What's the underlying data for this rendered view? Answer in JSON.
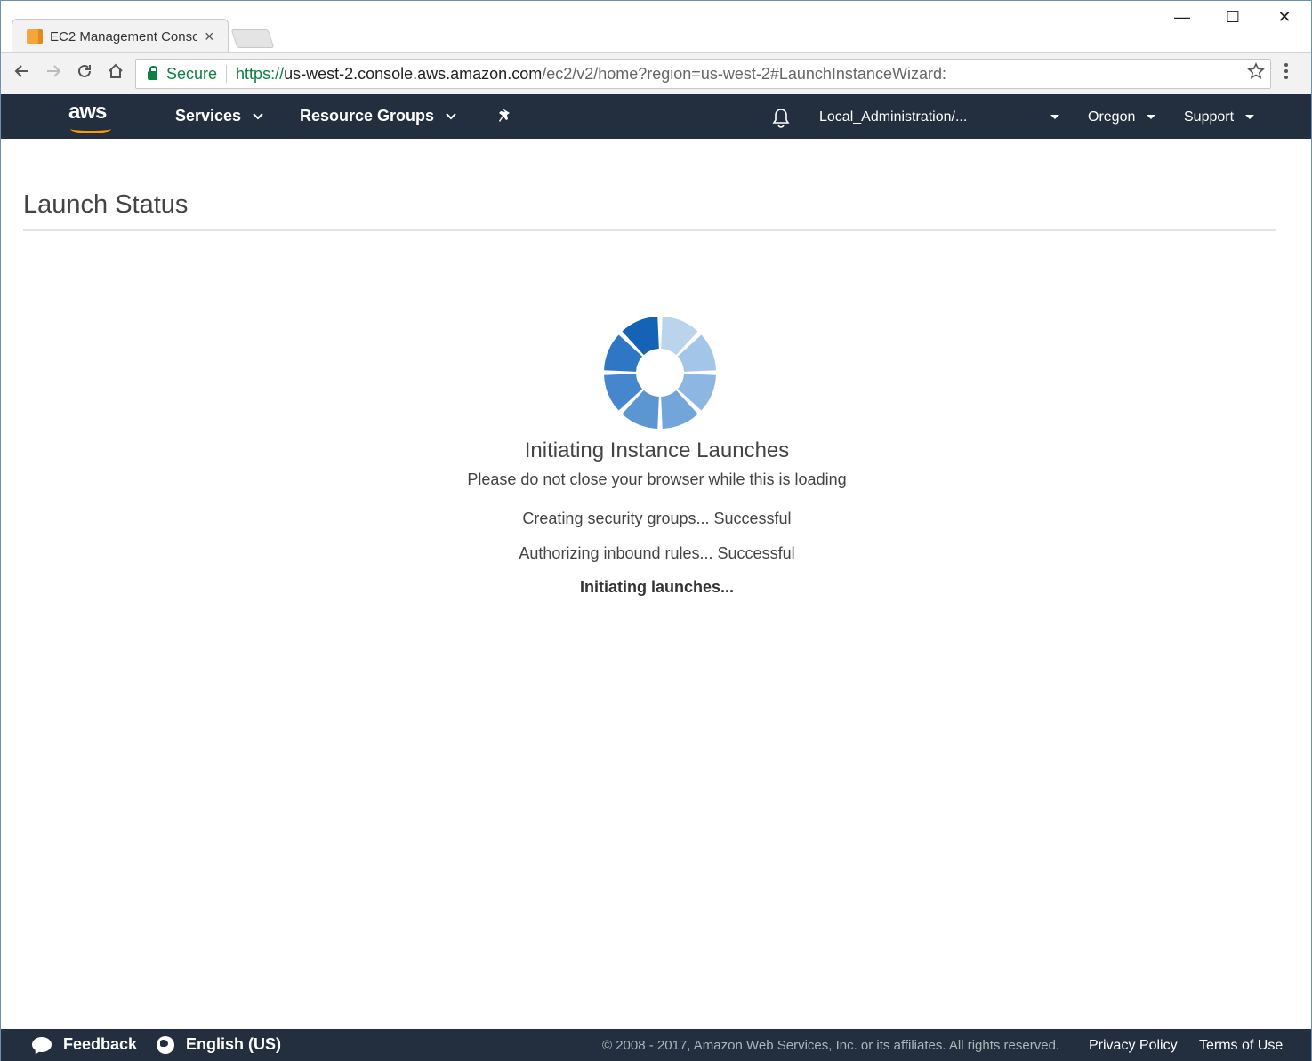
{
  "browser": {
    "tab_title": "EC2 Management Conso",
    "tab_close": "×",
    "url_scheme": "https://",
    "url_host": "us-west-2.console.aws.amazon.com",
    "url_path": "/ec2/v2/home?region=us-west-2#LaunchInstanceWizard:",
    "secure_label": "Secure",
    "minimize_glyph": "—",
    "maximize_glyph": "☐",
    "close_glyph": "✕",
    "back_icon": "arrow-left-icon",
    "forward_icon": "arrow-right-icon",
    "reload_icon": "reload-icon",
    "home_icon": "home-icon",
    "star_icon": "star-icon",
    "menu_icon": "vertical-dots-icon"
  },
  "aws_nav": {
    "logo_text": "aws",
    "services": "Services",
    "resource_groups": "Resource Groups",
    "pin_icon": "pushpin-icon",
    "bell_icon": "bell-icon",
    "account": "Local_Administration/...",
    "region": "Oregon",
    "support": "Support"
  },
  "page": {
    "title": "Launch Status",
    "loading": {
      "heading": "Initiating Instance Launches",
      "subheading": "Please do not close your browser while this is loading",
      "steps": [
        {
          "text": "Creating security groups... Successful",
          "bold": false
        },
        {
          "text": "Authorizing inbound rules... Successful",
          "bold": false
        },
        {
          "text": "Initiating launches...",
          "bold": true
        }
      ]
    }
  },
  "footer": {
    "feedback": "Feedback",
    "language": "English (US)",
    "copyright": "© 2008 - 2017, Amazon Web Services, Inc. or its affiliates. All rights reserved.",
    "privacy": "Privacy Policy",
    "terms": "Terms of Use"
  },
  "colors": {
    "nav_bg": "#232f3e",
    "aws_orange": "#ff9900",
    "secure_green": "#0b8043",
    "spinner_shades": [
      "#b9d4ec",
      "#a3c6e8",
      "#8db7e2",
      "#72a6da",
      "#5b95d2",
      "#4686cc",
      "#2f76c4",
      "#1463b6"
    ]
  }
}
